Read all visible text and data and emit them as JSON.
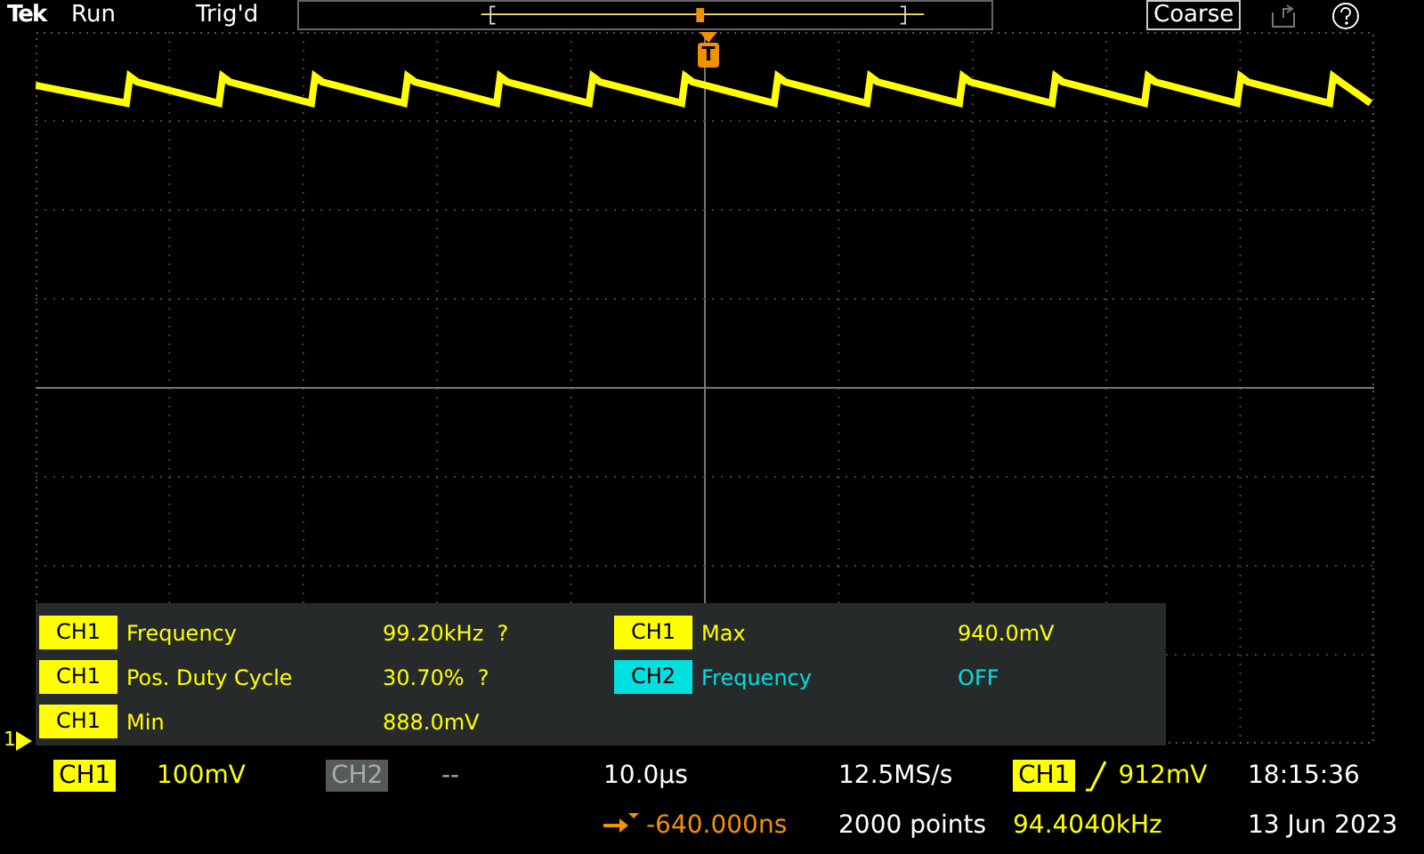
{
  "status": {
    "brand": "Tek",
    "run_state": "Run",
    "trigger_state": "Trig'd"
  },
  "coarse_button": "Coarse",
  "trigger_marker": "T",
  "channel_marker": "1",
  "measurements": [
    {
      "source": "CH1",
      "color": "#ffff00",
      "label": "Frequency",
      "value": "99.20kHz  ?"
    },
    {
      "source": "CH1",
      "color": "#ffff00",
      "label": "Pos. Duty Cycle",
      "value": "30.70%  ?"
    },
    {
      "source": "CH1",
      "color": "#ffff00",
      "label": "Min",
      "value": "888.0mV"
    },
    {
      "source": "CH1",
      "color": "#ffff00",
      "label": "Max",
      "value": "940.0mV"
    },
    {
      "source": "CH2",
      "color": "#00e0e0",
      "label": "Frequency",
      "value": "OFF"
    }
  ],
  "channels": [
    {
      "name": "CH1",
      "on": true,
      "scale": "100mV"
    },
    {
      "name": "CH2",
      "on": false,
      "scale": "--"
    }
  ],
  "horizontal": {
    "scale": "10.0µs",
    "position": "-640.000ns",
    "sample_rate": "12.5MS/s",
    "record_length": "2000 points"
  },
  "trigger": {
    "source": "CH1",
    "level": "912mV",
    "frequency": "94.4040kHz"
  },
  "clock": {
    "time": "18:15:36",
    "date": "13 Jun 2023"
  }
}
